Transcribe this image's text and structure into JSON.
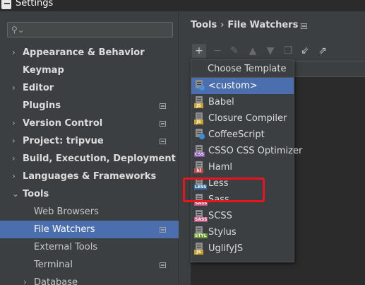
{
  "window": {
    "title": "Settings"
  },
  "search": {
    "placeholder": ""
  },
  "sidebar": {
    "items": [
      {
        "label": "Appearance & Behavior",
        "arrow": "›",
        "project": false
      },
      {
        "label": "Keymap",
        "arrow": "",
        "project": false
      },
      {
        "label": "Editor",
        "arrow": "›",
        "project": false
      },
      {
        "label": "Plugins",
        "arrow": "",
        "project": true
      },
      {
        "label": "Version Control",
        "arrow": "›",
        "project": true
      },
      {
        "label": "Project: tripvue",
        "arrow": "›",
        "project": true
      },
      {
        "label": "Build, Execution, Deployment",
        "arrow": "›",
        "project": false
      },
      {
        "label": "Languages & Frameworks",
        "arrow": "›",
        "project": false
      },
      {
        "label": "Tools",
        "arrow": "⌄",
        "project": false
      }
    ],
    "tools_children": [
      {
        "label": "Web Browsers",
        "project": false,
        "selected": false
      },
      {
        "label": "File Watchers",
        "project": true,
        "selected": true
      },
      {
        "label": "External Tools",
        "project": false,
        "selected": false
      },
      {
        "label": "Terminal",
        "project": true,
        "selected": false
      },
      {
        "label": "Database",
        "project": false,
        "selected": false,
        "arrow": "›"
      }
    ]
  },
  "breadcrumb": {
    "parent": "Tools",
    "separator": "›",
    "current": "File Watchers"
  },
  "toolbar": {
    "icons": [
      "add-icon",
      "remove-icon",
      "edit-icon",
      "move-up-icon",
      "move-down-icon",
      "copy-icon",
      "import-icon",
      "export-icon"
    ]
  },
  "popup": {
    "title": "Choose Template",
    "items": [
      {
        "label": "<custom>",
        "tag": "",
        "color": "#4a8fd8",
        "selected": true
      },
      {
        "label": "Babel",
        "tag": "JS",
        "color": "#c9a02a"
      },
      {
        "label": "Closure Compiler",
        "tag": "JS",
        "color": "#c9a02a"
      },
      {
        "label": "CoffeeScript",
        "tag": "",
        "color": "#3c8dd4"
      },
      {
        "label": "CSSO CSS Optimizer",
        "tag": "CSS",
        "color": "#8a4fb5"
      },
      {
        "label": "Haml",
        "tag": "hl",
        "color": "#c14a4a"
      },
      {
        "label": "Less",
        "tag": "LESS",
        "color": "#3a6ea8"
      },
      {
        "label": "Sass",
        "tag": "SASS",
        "color": "#c0507a"
      },
      {
        "label": "SCSS",
        "tag": "SASS",
        "color": "#c0507a"
      },
      {
        "label": "Stylus",
        "tag": "STYL",
        "color": "#6a9a2a"
      },
      {
        "label": "UglifyJS",
        "tag": "JS",
        "color": "#c9a02a"
      }
    ]
  },
  "colors": {
    "selection": "#4b6eaf",
    "background": "#3c3f41",
    "highlight": "#e8141e"
  }
}
